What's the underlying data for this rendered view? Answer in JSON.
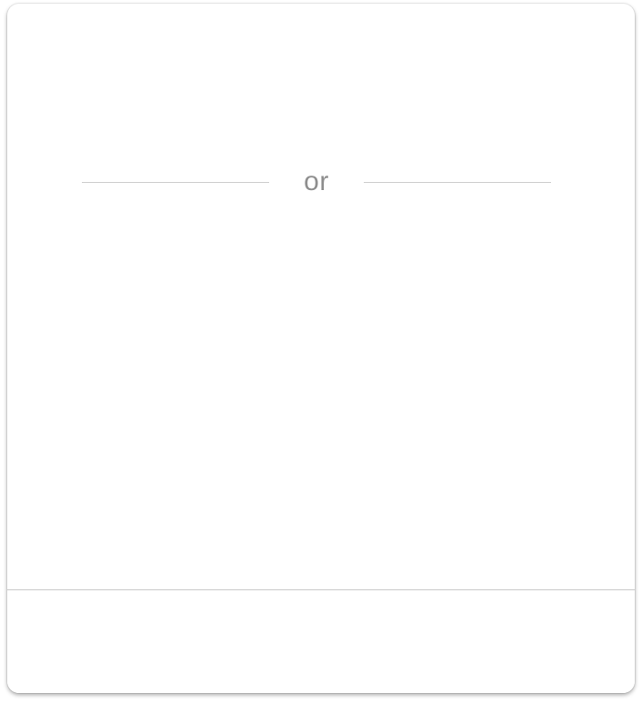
{
  "dialog": {
    "divider_text": "or"
  }
}
